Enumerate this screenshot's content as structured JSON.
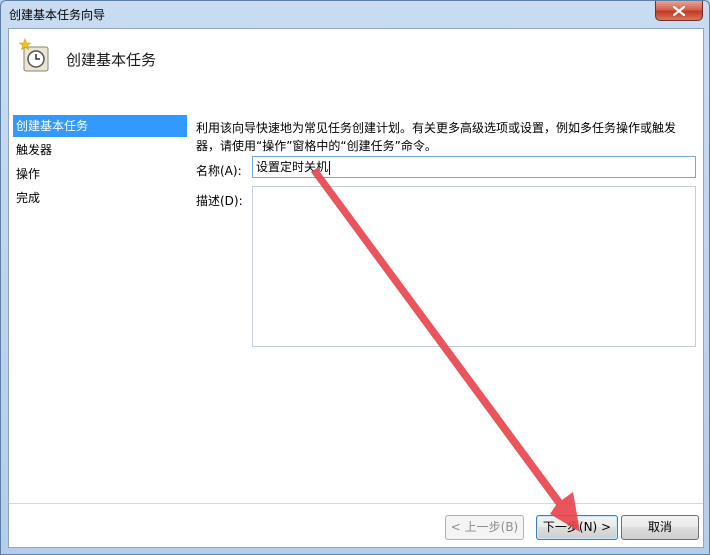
{
  "window": {
    "title": "创建基本任务向导"
  },
  "header": {
    "title": "创建基本任务"
  },
  "steps": [
    {
      "label": "创建基本任务",
      "active": true
    },
    {
      "label": "触发器",
      "active": false
    },
    {
      "label": "操作",
      "active": false
    },
    {
      "label": "完成",
      "active": false
    }
  ],
  "main": {
    "description": "利用该向导快速地为常见任务创建计划。有关更多高级选项或设置，例如多任务操作或触发器，请使用“操作”窗格中的“创建任务”命令。",
    "name_label": "名称(A):",
    "name_value": "设置定时关机",
    "desc_label": "描述(D):",
    "desc_value": ""
  },
  "buttons": {
    "back": "< 上一步(B)",
    "next": "下一步(N) >",
    "cancel": "取消"
  },
  "annotation": {
    "arrow_color": "#e8424b"
  }
}
